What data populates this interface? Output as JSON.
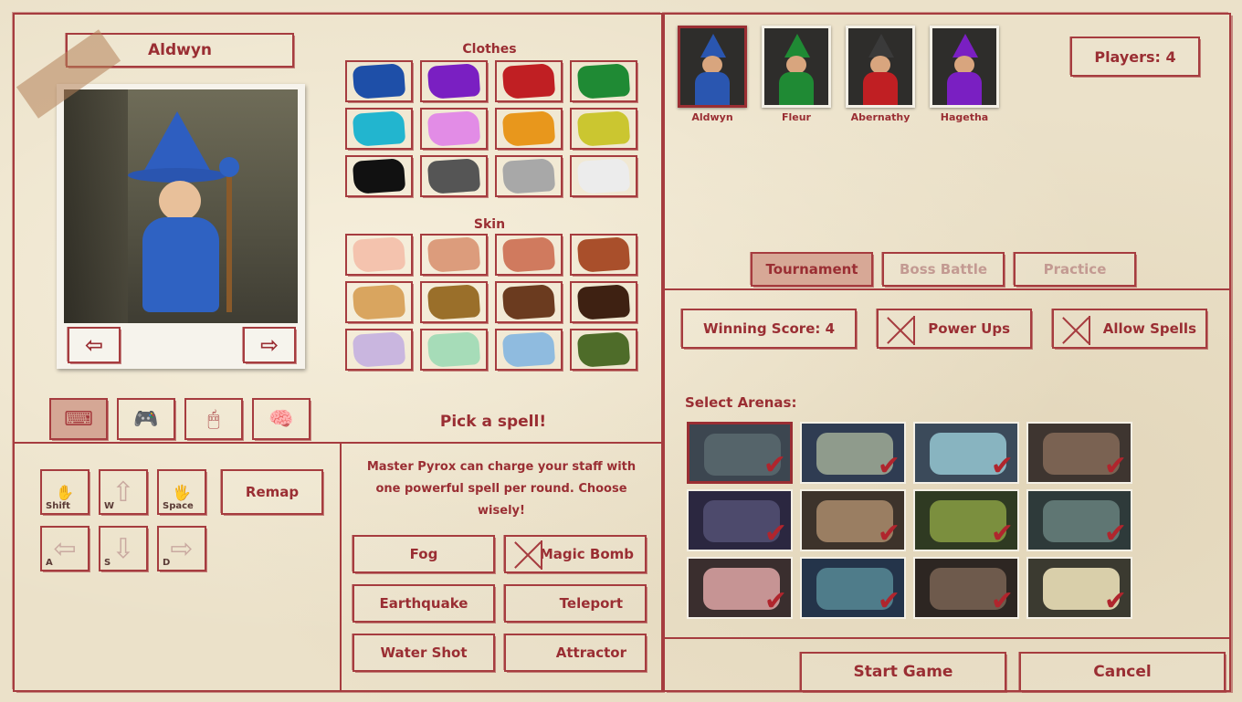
{
  "character": {
    "name": "Aldwyn",
    "prev_icon": "arrow-left-icon",
    "next_icon": "arrow-right-icon"
  },
  "clothes": {
    "title": "Clothes",
    "colors": [
      "#1e4fa8",
      "#7a1fc2",
      "#c01f23",
      "#1f8a34",
      "#22b5cf",
      "#e28ce6",
      "#e8971c",
      "#cbc630",
      "#111111",
      "#555555",
      "#a8a8a8",
      "#ececec"
    ]
  },
  "skin": {
    "title": "Skin",
    "colors": [
      "#f4c3ae",
      "#dc9c7c",
      "#d07a5e",
      "#a94f2b",
      "#d9a55f",
      "#9a6f2a",
      "#6b3b1f",
      "#3e2112",
      "#c9b6df",
      "#a6dcb8",
      "#8fbbdf",
      "#4e6c29"
    ]
  },
  "control_tabs": [
    {
      "icon": "keyboard-icon"
    },
    {
      "icon": "gamepad-icon"
    },
    {
      "icon": "mouse-icon"
    },
    {
      "icon": "brain-icon"
    }
  ],
  "keys": {
    "top": [
      {
        "label": "Shift",
        "icon": "hand-icon"
      },
      {
        "label": "W",
        "icon": "arrow-up-icon"
      },
      {
        "label": "Space",
        "icon": "hand-open-icon"
      }
    ],
    "bottom": [
      {
        "label": "A",
        "icon": "arrow-left-icon"
      },
      {
        "label": "S",
        "icon": "arrow-down-icon"
      },
      {
        "label": "D",
        "icon": "arrow-right-icon"
      }
    ],
    "remap_label": "Remap"
  },
  "spell": {
    "title": "Pick a spell!",
    "description": "Master Pyrox can charge your staff with one powerful spell per round. Choose wisely!",
    "options": [
      {
        "label": "Fog",
        "selected": false
      },
      {
        "label": "Magic Bomb",
        "selected": true
      },
      {
        "label": "Earthquake",
        "selected": false
      },
      {
        "label": "Teleport",
        "selected": false
      },
      {
        "label": "Water Shot",
        "selected": false
      },
      {
        "label": "Attractor",
        "selected": false
      }
    ]
  },
  "players": {
    "count_label": "Players: 4",
    "list": [
      {
        "name": "Aldwyn",
        "robe": "#2a56b0",
        "hat": "#2a56b0",
        "selected": true
      },
      {
        "name": "Fleur",
        "robe": "#1f8a34",
        "hat": "#1f8a34",
        "selected": false
      },
      {
        "name": "Abernathy",
        "robe": "#c01f23",
        "hat": "#3a3a3a",
        "selected": false
      },
      {
        "name": "Hagetha",
        "robe": "#7a1fc2",
        "hat": "#7a1fc2",
        "selected": false
      }
    ]
  },
  "modes": [
    {
      "label": "Tournament",
      "active": true
    },
    {
      "label": "Boss Battle",
      "active": false
    },
    {
      "label": "Practice",
      "active": false
    }
  ],
  "options": {
    "winning_score": "Winning Score: 4",
    "power_ups": "Power Ups",
    "allow_spells": "Allow Spells"
  },
  "arenas": {
    "title": "Select Arenas:",
    "list": [
      {
        "bg": "#3c4650",
        "floor": "#55646a",
        "selected": true
      },
      {
        "bg": "#2f3c52",
        "floor": "#8f9b8c",
        "selected": false
      },
      {
        "bg": "#3b4a5a",
        "floor": "#88b4c0",
        "selected": false
      },
      {
        "bg": "#3e3530",
        "floor": "#7a6252",
        "selected": false
      },
      {
        "bg": "#2b2740",
        "floor": "#4d4a6c",
        "selected": false
      },
      {
        "bg": "#3d332b",
        "floor": "#9a7e62",
        "selected": false
      },
      {
        "bg": "#2f3a22",
        "floor": "#7b8f3e",
        "selected": false
      },
      {
        "bg": "#2e3a3a",
        "floor": "#5f7673",
        "selected": false
      },
      {
        "bg": "#3a2e2e",
        "floor": "#c69494",
        "selected": false
      },
      {
        "bg": "#24344a",
        "floor": "#4f7c8a",
        "selected": false
      },
      {
        "bg": "#2d2622",
        "floor": "#6e5a4c",
        "selected": false
      },
      {
        "bg": "#3b3a30",
        "floor": "#d9cfaa",
        "selected": false
      }
    ]
  },
  "footer": {
    "start": "Start Game",
    "cancel": "Cancel"
  }
}
